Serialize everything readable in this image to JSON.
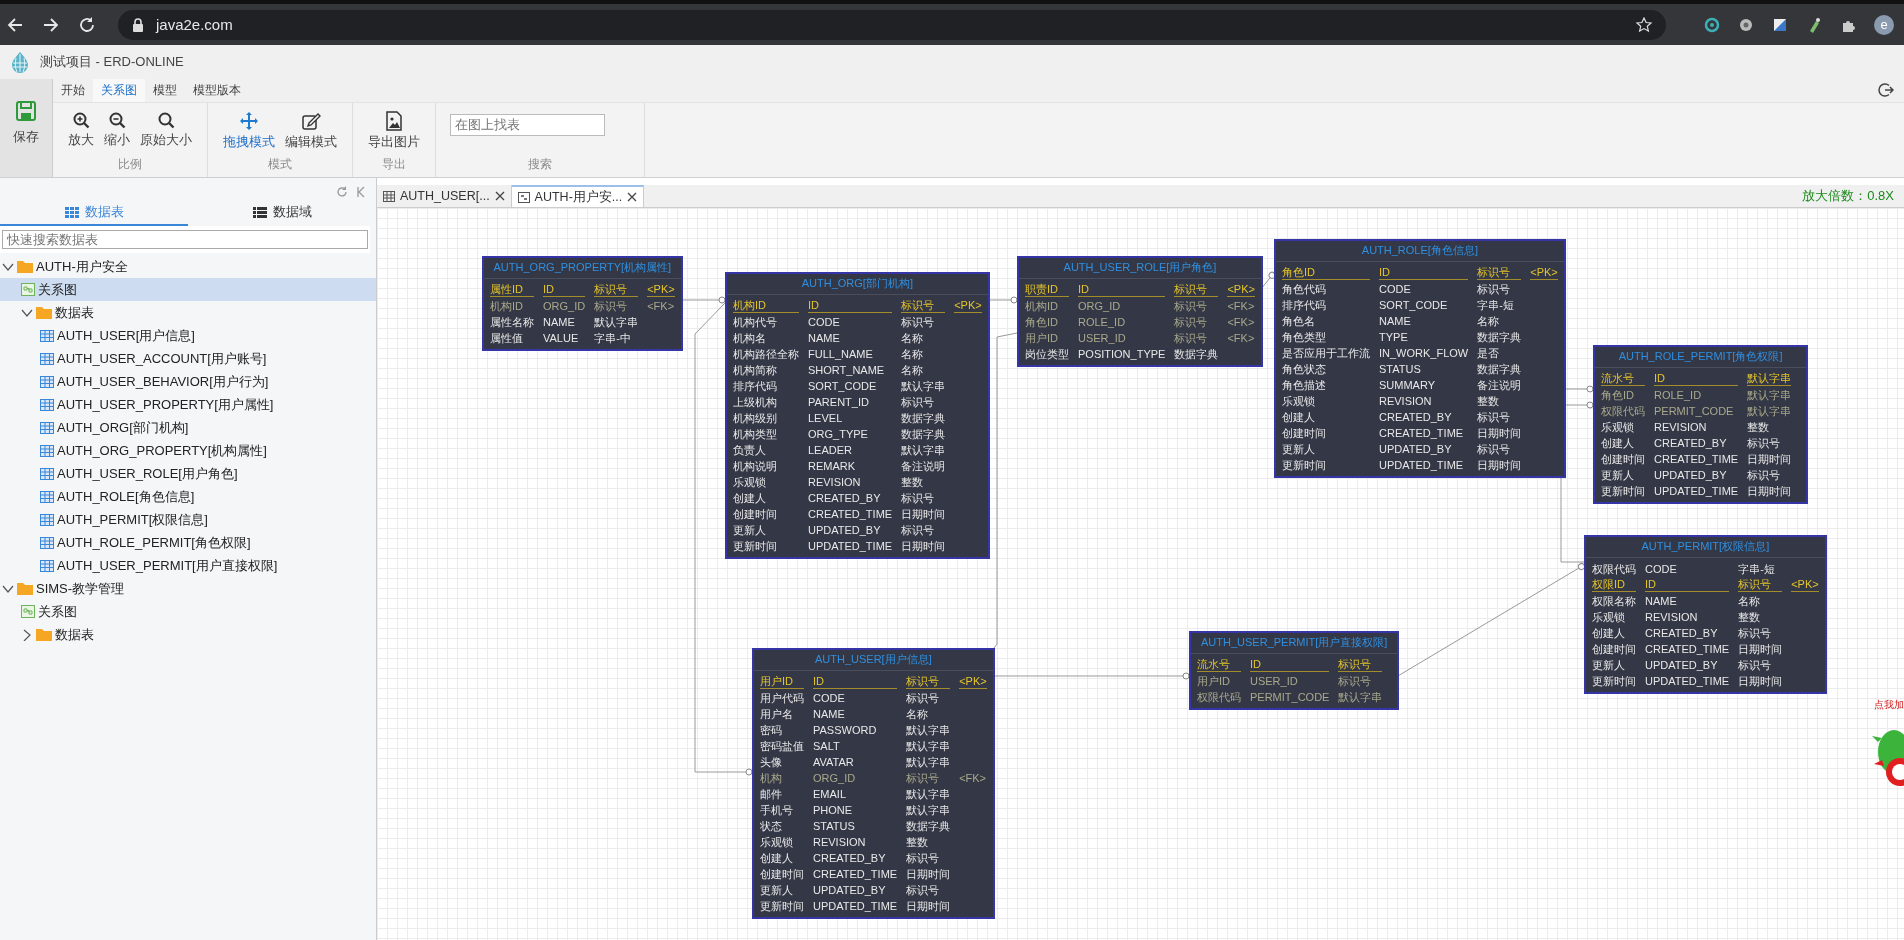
{
  "browser": {
    "url": "java2e.com",
    "profile_initial": "e"
  },
  "app": {
    "title": "测试项目 - ERD-ONLINE"
  },
  "ribbon": {
    "tabs": [
      {
        "label": "开始",
        "selected": false
      },
      {
        "label": "关系图",
        "selected": true
      },
      {
        "label": "模型",
        "selected": false
      },
      {
        "label": "模型版本",
        "selected": false
      }
    ],
    "save": {
      "label": "保存"
    },
    "groups": [
      {
        "label": "比例",
        "buttons": [
          {
            "label": "放大",
            "kind": "zoom_in",
            "selected": false
          },
          {
            "label": "缩小",
            "kind": "zoom_out",
            "selected": false
          },
          {
            "label": "原始大小",
            "kind": "zoom_reset",
            "selected": false
          }
        ]
      },
      {
        "label": "模式",
        "buttons": [
          {
            "label": "拖拽模式",
            "kind": "drag",
            "selected": true
          },
          {
            "label": "编辑模式",
            "kind": "edit",
            "selected": false
          }
        ]
      },
      {
        "label": "导出",
        "buttons": [
          {
            "label": "导出图片",
            "kind": "export_image",
            "selected": false
          }
        ]
      },
      {
        "label": "搜索",
        "field": {
          "placeholder": "在图上找表"
        }
      }
    ]
  },
  "sidebar": {
    "tabs": [
      {
        "label": "数据表",
        "kind": "grid",
        "selected": true
      },
      {
        "label": "数据域",
        "kind": "list",
        "selected": false
      }
    ],
    "search": {
      "placeholder": "快速搜索数据表"
    },
    "tree": [
      {
        "label": "AUTH-用户安全",
        "kind": "folder",
        "selected": false,
        "expanded": true,
        "children": [
          {
            "label": "关系图",
            "kind": "diagram",
            "selected": true
          },
          {
            "label": "数据表",
            "kind": "folder",
            "selected": false,
            "expanded": true,
            "children": [
              {
                "label": "AUTH_USER[用户信息]",
                "kind": "table",
                "selected": false
              },
              {
                "label": "AUTH_USER_ACCOUNT[用户账号]",
                "kind": "table",
                "selected": false
              },
              {
                "label": "AUTH_USER_BEHAVIOR[用户行为]",
                "kind": "table",
                "selected": false
              },
              {
                "label": "AUTH_USER_PROPERTY[用户属性]",
                "kind": "table",
                "selected": false
              },
              {
                "label": "AUTH_ORG[部门机构]",
                "kind": "table",
                "selected": false
              },
              {
                "label": "AUTH_ORG_PROPERTY[机构属性]",
                "kind": "table",
                "selected": false
              },
              {
                "label": "AUTH_USER_ROLE[用户角色]",
                "kind": "table",
                "selected": false
              },
              {
                "label": "AUTH_ROLE[角色信息]",
                "kind": "table",
                "selected": false
              },
              {
                "label": "AUTH_PERMIT[权限信息]",
                "kind": "table",
                "selected": false
              },
              {
                "label": "AUTH_ROLE_PERMIT[角色权限]",
                "kind": "table",
                "selected": false
              },
              {
                "label": "AUTH_USER_PERMIT[用户直接权限]",
                "kind": "table",
                "selected": false
              }
            ]
          }
        ]
      },
      {
        "label": "SIMS-教学管理",
        "kind": "folder",
        "selected": false,
        "expanded": true,
        "children": [
          {
            "label": "关系图",
            "kind": "diagram",
            "selected": false
          },
          {
            "label": "数据表",
            "kind": "folder",
            "selected": false,
            "expanded": false
          }
        ]
      }
    ]
  },
  "canvas": {
    "tabs": [
      {
        "label": "AUTH_USER[...",
        "kind": "table",
        "selected": false
      },
      {
        "label": "AUTH-用户安...",
        "kind": "diagram",
        "selected": true
      }
    ],
    "zoom_label": "放大倍数：0.8X",
    "tables": [
      {
        "title": "AUTH_ORG_PROPERTY[机构属性]",
        "rows": [
          {
            "kind": "pk",
            "cells": [
              "属性ID",
              "ID",
              "标识号",
              "<PK>"
            ]
          },
          {
            "kind": "fk",
            "cells": [
              "机构ID",
              "ORG_ID",
              "标识号",
              "<FK>"
            ]
          },
          {
            "kind": "plain",
            "cells": [
              "属性名称",
              "NAME",
              "默认字串"
            ]
          },
          {
            "kind": "plain",
            "cells": [
              "属性值",
              "VALUE",
              "字串-中"
            ]
          }
        ]
      },
      {
        "title": "AUTH_ORG[部门机构]",
        "rows": [
          {
            "kind": "pk",
            "cells": [
              "机构ID",
              "ID",
              "标识号",
              "<PK>"
            ]
          },
          {
            "kind": "plain",
            "cells": [
              "机构代号",
              "CODE",
              "标识号"
            ]
          },
          {
            "kind": "plain",
            "cells": [
              "机构名",
              "NAME",
              "名称"
            ]
          },
          {
            "kind": "plain",
            "cells": [
              "机构路径全称",
              "FULL_NAME",
              "名称"
            ]
          },
          {
            "kind": "plain",
            "cells": [
              "机构简称",
              "SHORT_NAME",
              "名称"
            ]
          },
          {
            "kind": "plain",
            "cells": [
              "排序代码",
              "SORT_CODE",
              "默认字串"
            ]
          },
          {
            "kind": "plain",
            "cells": [
              "上级机构",
              "PARENT_ID",
              "标识号"
            ]
          },
          {
            "kind": "plain",
            "cells": [
              "机构级别",
              "LEVEL",
              "数据字典"
            ]
          },
          {
            "kind": "plain",
            "cells": [
              "机构类型",
              "ORG_TYPE",
              "数据字典"
            ]
          },
          {
            "kind": "plain",
            "cells": [
              "负责人",
              "LEADER",
              "默认字串"
            ]
          },
          {
            "kind": "plain",
            "cells": [
              "机构说明",
              "REMARK",
              "备注说明"
            ]
          },
          {
            "kind": "plain",
            "cells": [
              "乐观锁",
              "REVISION",
              "整数"
            ]
          },
          {
            "kind": "plain",
            "cells": [
              "创建人",
              "CREATED_BY",
              "标识号"
            ]
          },
          {
            "kind": "plain",
            "cells": [
              "创建时间",
              "CREATED_TIME",
              "日期时间"
            ]
          },
          {
            "kind": "plain",
            "cells": [
              "更新人",
              "UPDATED_BY",
              "标识号"
            ]
          },
          {
            "kind": "plain",
            "cells": [
              "更新时间",
              "UPDATED_TIME",
              "日期时间"
            ]
          }
        ]
      },
      {
        "title": "AUTH_USER_ROLE[用户角色]",
        "rows": [
          {
            "kind": "pk",
            "cells": [
              "职责ID",
              "ID",
              "标识号",
              "<PK>"
            ]
          },
          {
            "kind": "fk",
            "cells": [
              "机构ID",
              "ORG_ID",
              "标识号",
              "<FK>"
            ]
          },
          {
            "kind": "fk",
            "cells": [
              "角色ID",
              "ROLE_ID",
              "标识号",
              "<FK>"
            ]
          },
          {
            "kind": "fk",
            "cells": [
              "用户ID",
              "USER_ID",
              "标识号",
              "<FK>"
            ]
          },
          {
            "kind": "plain",
            "cells": [
              "岗位类型",
              "POSITION_TYPE",
              "数据字典"
            ]
          }
        ]
      },
      {
        "title": "AUTH_ROLE[角色信息]",
        "rows": [
          {
            "kind": "pk",
            "cells": [
              "角色ID",
              "ID",
              "标识号",
              "<PK>"
            ]
          },
          {
            "kind": "plain",
            "cells": [
              "角色代码",
              "CODE",
              "标识号"
            ]
          },
          {
            "kind": "plain",
            "cells": [
              "排序代码",
              "SORT_CODE",
              "字串-短"
            ]
          },
          {
            "kind": "plain",
            "cells": [
              "角色名",
              "NAME",
              "名称"
            ]
          },
          {
            "kind": "plain",
            "cells": [
              "角色类型",
              "TYPE",
              "数据字典"
            ]
          },
          {
            "kind": "plain",
            "cells": [
              "是否应用于工作流",
              "IN_WORK_FLOW",
              "是否"
            ]
          },
          {
            "kind": "plain",
            "cells": [
              "角色状态",
              "STATUS",
              "数据字典"
            ]
          },
          {
            "kind": "plain",
            "cells": [
              "角色描述",
              "SUMMARY",
              "备注说明"
            ]
          },
          {
            "kind": "plain",
            "cells": [
              "乐观锁",
              "REVISION",
              "整数"
            ]
          },
          {
            "kind": "plain",
            "cells": [
              "创建人",
              "CREATED_BY",
              "标识号"
            ]
          },
          {
            "kind": "plain",
            "cells": [
              "创建时间",
              "CREATED_TIME",
              "日期时间"
            ]
          },
          {
            "kind": "plain",
            "cells": [
              "更新人",
              "UPDATED_BY",
              "标识号"
            ]
          },
          {
            "kind": "plain",
            "cells": [
              "更新时间",
              "UPDATED_TIME",
              "日期时间"
            ]
          }
        ]
      },
      {
        "title": "AUTH_ROLE_PERMIT[角色权限]",
        "rows": [
          {
            "kind": "pk",
            "cells": [
              "流水号",
              "ID",
              "默认字串"
            ]
          },
          {
            "kind": "fk",
            "cells": [
              "角色ID",
              "ROLE_ID",
              "默认字串"
            ]
          },
          {
            "kind": "fk",
            "cells": [
              "权限代码",
              "PERMIT_CODE",
              "默认字串"
            ]
          },
          {
            "kind": "plain",
            "cells": [
              "乐观锁",
              "REVISION",
              "整数"
            ]
          },
          {
            "kind": "plain",
            "cells": [
              "创建人",
              "CREATED_BY",
              "标识号"
            ]
          },
          {
            "kind": "plain",
            "cells": [
              "创建时间",
              "CREATED_TIME",
              "日期时间"
            ]
          },
          {
            "kind": "plain",
            "cells": [
              "更新人",
              "UPDATED_BY",
              "标识号"
            ]
          },
          {
            "kind": "plain",
            "cells": [
              "更新时间",
              "UPDATED_TIME",
              "日期时间"
            ]
          }
        ]
      },
      {
        "title": "AUTH_PERMIT[权限信息]",
        "rows": [
          {
            "kind": "plain",
            "cells": [
              "权限代码",
              "CODE",
              "字串-短"
            ]
          },
          {
            "kind": "pk",
            "cells": [
              "权限ID",
              "ID",
              "标识号",
              "<PK>"
            ]
          },
          {
            "kind": "plain",
            "cells": [
              "权限名称",
              "NAME",
              "名称"
            ]
          },
          {
            "kind": "plain",
            "cells": [
              "乐观锁",
              "REVISION",
              "整数"
            ]
          },
          {
            "kind": "plain",
            "cells": [
              "创建人",
              "CREATED_BY",
              "标识号"
            ]
          },
          {
            "kind": "plain",
            "cells": [
              "创建时间",
              "CREATED_TIME",
              "日期时间"
            ]
          },
          {
            "kind": "plain",
            "cells": [
              "更新人",
              "UPDATED_BY",
              "标识号"
            ]
          },
          {
            "kind": "plain",
            "cells": [
              "更新时间",
              "UPDATED_TIME",
              "日期时间"
            ]
          }
        ]
      },
      {
        "title": "AUTH_USER[用户信息]",
        "rows": [
          {
            "kind": "pk",
            "cells": [
              "用户ID",
              "ID",
              "标识号",
              "<PK>"
            ]
          },
          {
            "kind": "plain",
            "cells": [
              "用户代码",
              "CODE",
              "标识号"
            ]
          },
          {
            "kind": "plain",
            "cells": [
              "用户名",
              "NAME",
              "名称"
            ]
          },
          {
            "kind": "plain",
            "cells": [
              "密码",
              "PASSWORD",
              "默认字串"
            ]
          },
          {
            "kind": "plain",
            "cells": [
              "密码盐值",
              "SALT",
              "默认字串"
            ]
          },
          {
            "kind": "plain",
            "cells": [
              "头像",
              "AVATAR",
              "默认字串"
            ]
          },
          {
            "kind": "fk",
            "cells": [
              "机构",
              "ORG_ID",
              "标识号",
              "<FK>"
            ]
          },
          {
            "kind": "plain",
            "cells": [
              "邮件",
              "EMAIL",
              "默认字串"
            ]
          },
          {
            "kind": "plain",
            "cells": [
              "手机号",
              "PHONE",
              "默认字串"
            ]
          },
          {
            "kind": "plain",
            "cells": [
              "状态",
              "STATUS",
              "数据字典"
            ]
          },
          {
            "kind": "plain",
            "cells": [
              "乐观锁",
              "REVISION",
              "整数"
            ]
          },
          {
            "kind": "plain",
            "cells": [
              "创建人",
              "CREATED_BY",
              "标识号"
            ]
          },
          {
            "kind": "plain",
            "cells": [
              "创建时间",
              "CREATED_TIME",
              "日期时间"
            ]
          },
          {
            "kind": "plain",
            "cells": [
              "更新人",
              "UPDATED_BY",
              "标识号"
            ]
          },
          {
            "kind": "plain",
            "cells": [
              "更新时间",
              "UPDATED_TIME",
              "日期时间"
            ]
          }
        ]
      },
      {
        "title": "AUTH_USER_PERMIT[用户直接权限]",
        "rows": [
          {
            "kind": "pk",
            "cells": [
              "流水号",
              "ID",
              "标识号"
            ]
          },
          {
            "kind": "fk",
            "cells": [
              "用户ID",
              "USER_ID",
              "标识号"
            ]
          },
          {
            "kind": "fk",
            "cells": [
              "权限代码",
              "PERMIT_CODE",
              "默认字串"
            ]
          }
        ]
      }
    ]
  },
  "floating_widget": {
    "text": "点我加"
  }
}
